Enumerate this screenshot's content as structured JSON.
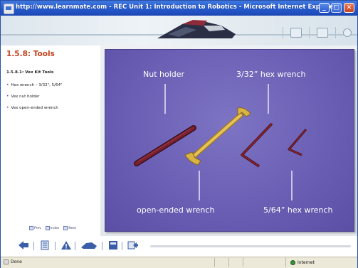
{
  "window": {
    "title": "http://www.learnmate.com - REC Unit 1: Introduction to Robotics - Microsoft Internet Explorer",
    "title_bar_color": "#2457c9"
  },
  "banner": {
    "icons": [
      "module-icon",
      "print-icon",
      "help-icon"
    ]
  },
  "left_panel": {
    "section_title": "1.5.8: Tools",
    "section_title_color": "#c2401b",
    "subtitle": "1.5.8.1: Vex Kit Tools",
    "bullets": [
      "Hex wrench – 3/32\", 5/64\"",
      "Vex nut holder",
      "Vex open-ended wrench"
    ],
    "nav": {
      "prev": "Prev",
      "index": "Index",
      "next": "Next"
    }
  },
  "slide": {
    "background_color": "#6a5fb4",
    "labels": {
      "nut_holder": "Nut holder",
      "hex_332": "3/32” hex wrench",
      "open_wrench": "open-ended wrench",
      "hex_564": "5/64” hex wrench"
    }
  },
  "toolbar": {
    "icons": [
      "back-arrow-icon",
      "notes-icon",
      "warning-icon",
      "robot-icon",
      "glossary-icon",
      "exit-icon"
    ]
  },
  "status_bar": {
    "left_text": "Done",
    "zone_text": "Internet"
  }
}
